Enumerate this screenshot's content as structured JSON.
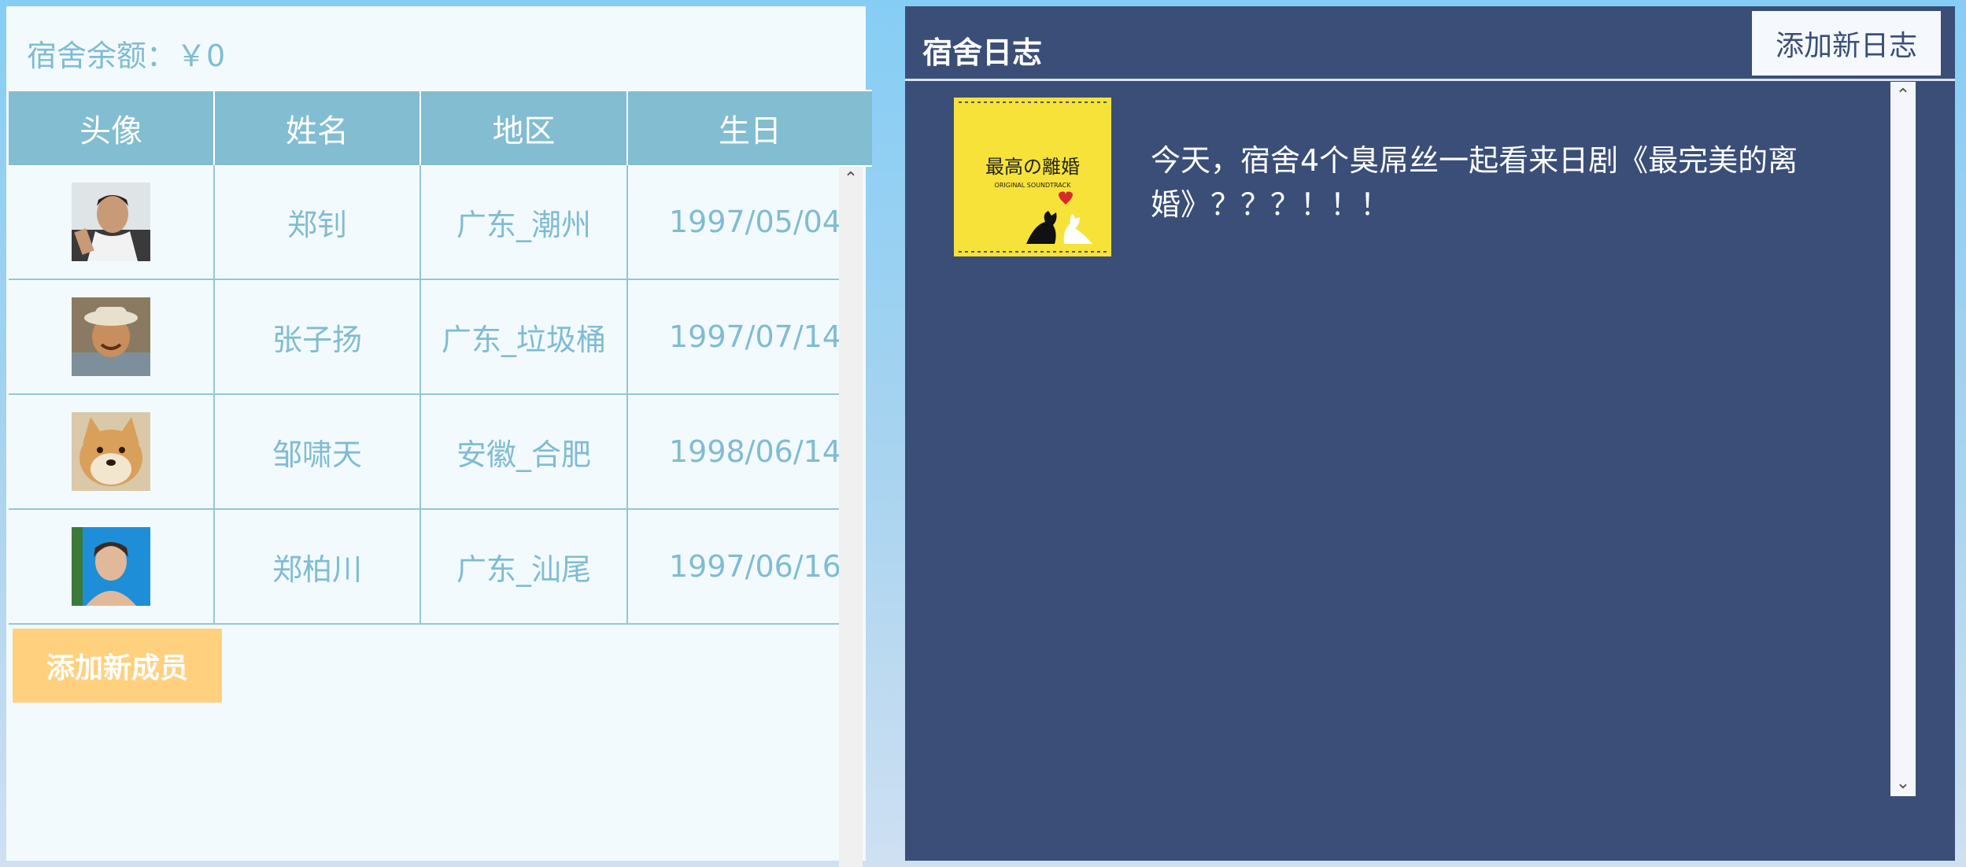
{
  "balance": {
    "label": "宿舍余额：￥0"
  },
  "members_table": {
    "headers": [
      "头像",
      "姓名",
      "地区",
      "生日"
    ],
    "rows": [
      {
        "avatar": "avatar-man-portrait",
        "name": "郑钊",
        "region": "广东_潮州",
        "birthday": "1997/05/04"
      },
      {
        "avatar": "avatar-man-with-hat",
        "name": "张子扬",
        "region": "广东_垃圾桶",
        "birthday": "1997/07/14"
      },
      {
        "avatar": "avatar-shiba-dog",
        "name": "邹啸天",
        "region": "安徽_合肥",
        "birthday": "1998/06/14"
      },
      {
        "avatar": "avatar-boy-blue-background",
        "name": "郑柏川",
        "region": "广东_汕尾",
        "birthday": "1997/06/16"
      }
    ],
    "add_button_label": "添加新成员"
  },
  "dorm_log": {
    "title": "宿舍日志",
    "add_button_label": "添加新日志",
    "entries": [
      {
        "thumbnail": "drama-soundtrack-cover",
        "thumbnail_title": "最高の離婚",
        "thumbnail_subtitle": "ORIGINAL SOUNDTRACK",
        "text": "今天，宿舍4个臭屌丝一起看来日剧《最完美的离婚》？？？！！！"
      }
    ]
  },
  "colors": {
    "left_panel_bg": "#f3fafd",
    "table_header_bg": "#82bdd2",
    "cell_text": "#7fbcd3",
    "add_member_bg": "#ffd17f",
    "right_panel_bg": "#3a4e78"
  }
}
